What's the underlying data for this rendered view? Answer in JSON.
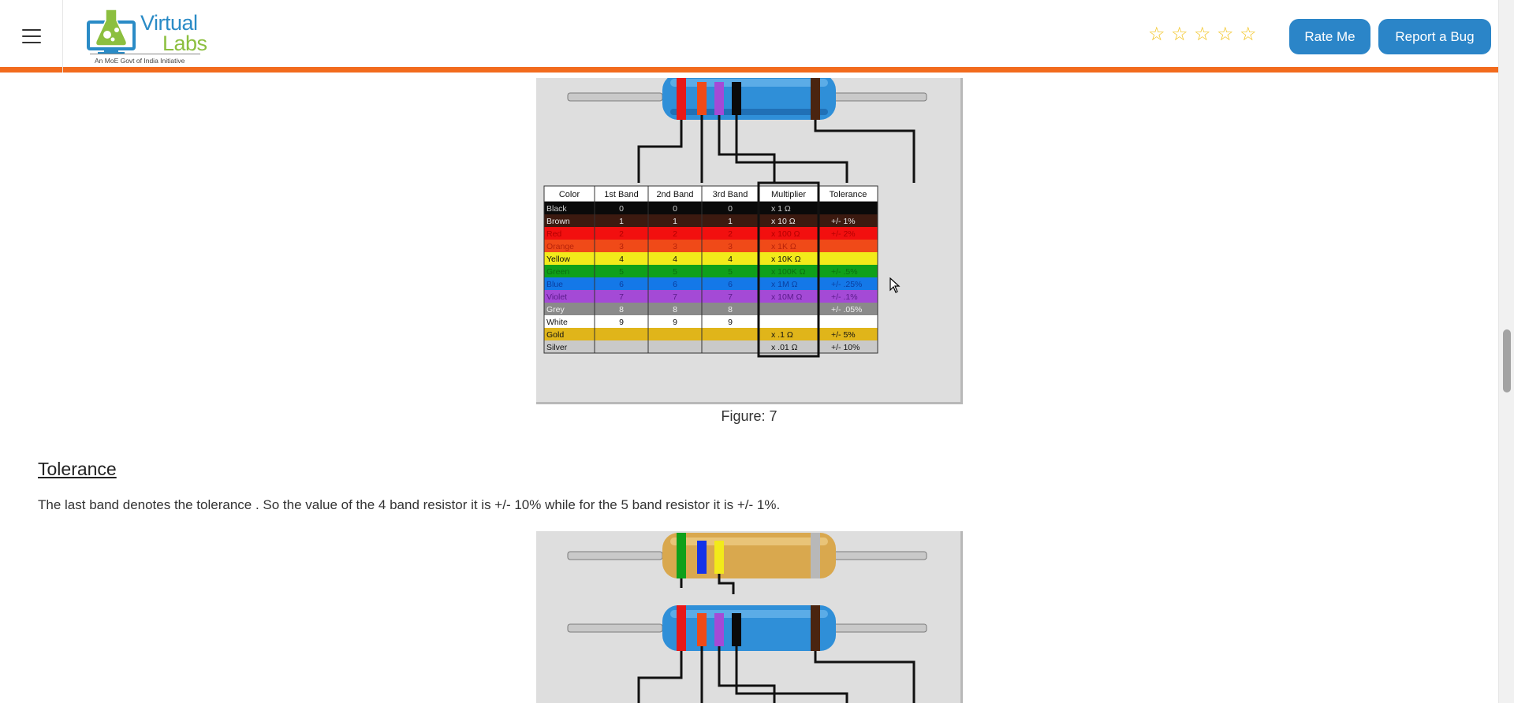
{
  "header": {
    "logo_line1": "Virtual",
    "logo_line2": "Labs",
    "logo_tagline": "An MoE Govt of India Initiative",
    "rating_stars": 5,
    "rate_button": "Rate Me",
    "bug_button": "Report a Bug",
    "menu_icon": "hamburger-icon",
    "star_icon": "star-outline-icon",
    "accent_color": "#f26b1d",
    "button_color": "#2b85c8"
  },
  "figure_table": {
    "headers": [
      "Color",
      "1st Band",
      "2nd Band",
      "3rd Band",
      "Multiplier",
      "Tolerance"
    ],
    "rows": [
      {
        "color": "Black",
        "b1": "0",
        "b2": "0",
        "b3": "0",
        "mult": "x 1 Ω",
        "tol": "",
        "bg": "#0a0a0a",
        "fg": "#cfcfcf"
      },
      {
        "color": "Brown",
        "b1": "1",
        "b2": "1",
        "b3": "1",
        "mult": "x 10 Ω",
        "tol": "+/-  1%",
        "bg": "#3c1a10",
        "fg": "#e8e8e8"
      },
      {
        "color": "Red",
        "b1": "2",
        "b2": "2",
        "b3": "2",
        "mult": "x 100 Ω",
        "tol": "+/-  2%",
        "bg": "#f20f0f",
        "fg": "#b30000"
      },
      {
        "color": "Orange",
        "b1": "3",
        "b2": "3",
        "b3": "3",
        "mult": "x 1K Ω",
        "tol": "",
        "bg": "#f04a18",
        "fg": "#b8230a"
      },
      {
        "color": "Yellow",
        "b1": "4",
        "b2": "4",
        "b3": "4",
        "mult": "x 10K Ω",
        "tol": "",
        "bg": "#f2ea1a",
        "fg": "#111111"
      },
      {
        "color": "Green",
        "b1": "5",
        "b2": "5",
        "b3": "5",
        "mult": "x 100K Ω",
        "tol": "+/-  .5%",
        "bg": "#0fa01a",
        "fg": "#0b6d10"
      },
      {
        "color": "Blue",
        "b1": "6",
        "b2": "6",
        "b3": "6",
        "mult": "x 1M Ω",
        "tol": "+/-  .25%",
        "bg": "#1478e8",
        "fg": "#0a3fa0"
      },
      {
        "color": "Violet",
        "b1": "7",
        "b2": "7",
        "b3": "7",
        "mult": "x 10M Ω",
        "tol": "+/-  .1%",
        "bg": "#a44ad6",
        "fg": "#5a1a8a"
      },
      {
        "color": "Grey",
        "b1": "8",
        "b2": "8",
        "b3": "8",
        "mult": "",
        "tol": "+/-  .05%",
        "bg": "#8a8a8a",
        "fg": "#f0f0f0"
      },
      {
        "color": "White",
        "b1": "9",
        "b2": "9",
        "b3": "9",
        "mult": "",
        "tol": "",
        "bg": "#ffffff",
        "fg": "#111111"
      },
      {
        "color": "Gold",
        "b1": "",
        "b2": "",
        "b3": "",
        "mult": "x .1 Ω",
        "tol": "+/-  5%",
        "bg": "#e0b51a",
        "fg": "#111111"
      },
      {
        "color": "Silver",
        "b1": "",
        "b2": "",
        "b3": "",
        "mult": "x .01 Ω",
        "tol": "+/-  10%",
        "bg": "#c9c9c9",
        "fg": "#111111"
      }
    ]
  },
  "figure_caption": "Figure: 7",
  "section": {
    "title": "Tolerance",
    "text": "The last band denotes the tolerance . So the value of the 4 band resistor it is +/- 10% while for the 5 band resistor it is +/- 1%."
  }
}
